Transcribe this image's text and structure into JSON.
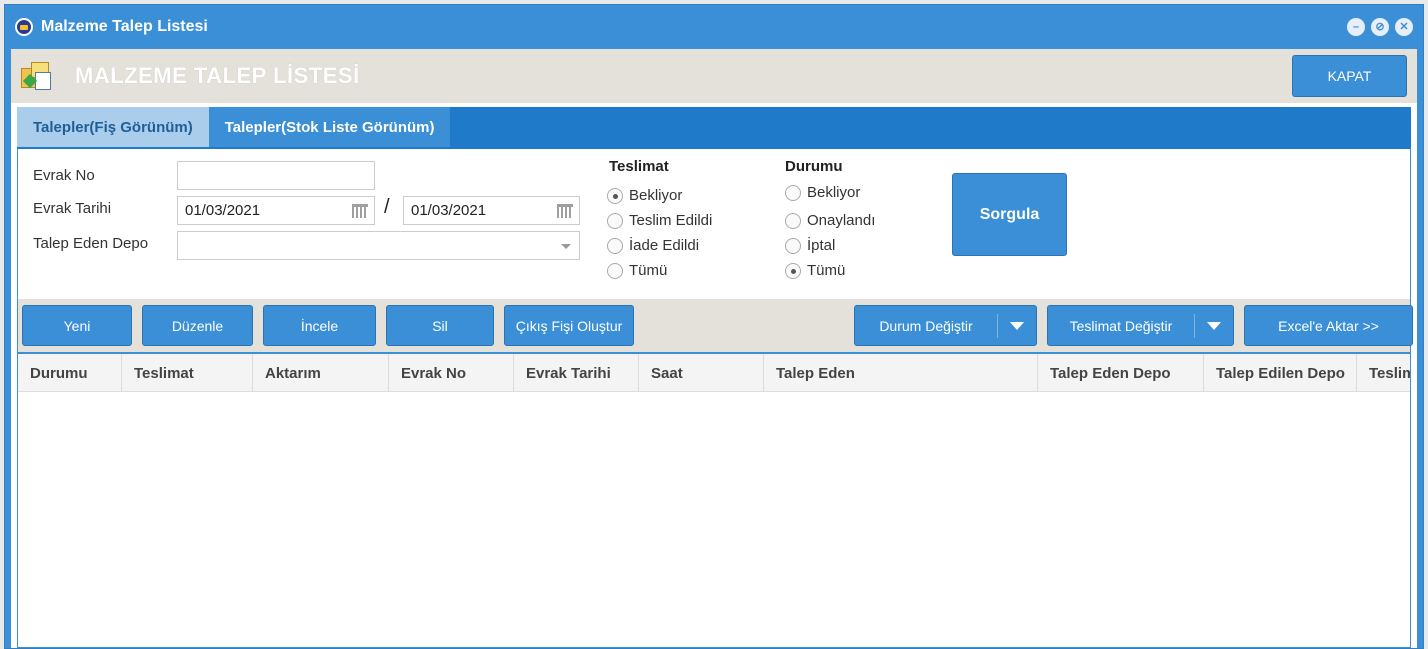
{
  "window": {
    "title": "Malzeme Talep Listesi"
  },
  "header": {
    "title": "MALZEME TALEP LİSTESİ",
    "close_label": "KAPAT"
  },
  "tabs": [
    {
      "label": "Talepler(Fiş Görünüm)",
      "active": true
    },
    {
      "label": "Talepler(Stok Liste Görünüm)",
      "active": false
    }
  ],
  "form": {
    "evrak_no_label": "Evrak No",
    "evrak_no_value": "",
    "evrak_tarihi_label": "Evrak Tarihi",
    "date_from": "01/03/2021",
    "date_separator": "/",
    "date_to": "01/03/2021",
    "talep_eden_depo_label": "Talep Eden Depo",
    "talep_eden_depo_value": ""
  },
  "teslimat": {
    "title": "Teslimat",
    "options": [
      "Bekliyor",
      "Teslim Edildi",
      "İade Edildi",
      "Tümü"
    ],
    "selected": "Bekliyor"
  },
  "durumu": {
    "title": "Durumu",
    "options": [
      "Bekliyor",
      "Onaylandı",
      "İptal",
      "Tümü"
    ],
    "selected": "Tümü"
  },
  "sorgula_label": "Sorgula",
  "toolbar": {
    "yeni": "Yeni",
    "duzenle": "Düzenle",
    "incele": "İncele",
    "sil": "Sil",
    "cikis_fisi": "Çıkış Fişi Oluştur",
    "durum_degistir": "Durum Değiştir",
    "teslimat_degistir": "Teslimat Değiştir",
    "excel": "Excel'e Aktar >>"
  },
  "grid": {
    "columns": [
      "Durumu",
      "Teslimat",
      "Aktarım",
      "Evrak No",
      "Evrak Tarihi",
      "Saat",
      "Talep Eden",
      "Talep Eden Depo",
      "Talep Edilen Depo",
      "Teslim"
    ],
    "rows": []
  },
  "icons": {
    "app": "app-logo-icon",
    "header": "package-request-icon",
    "calendar": "calendar-icon",
    "dropdown": "chevron-down-icon"
  }
}
